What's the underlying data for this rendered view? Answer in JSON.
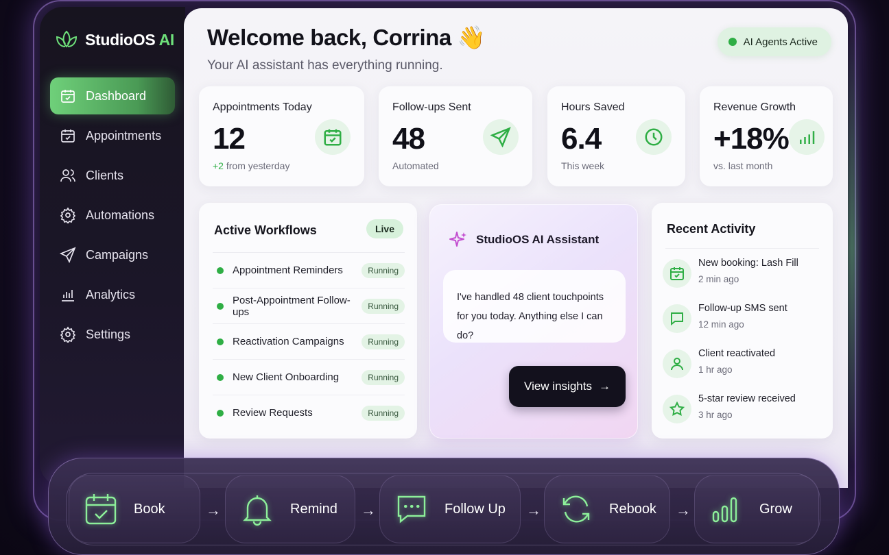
{
  "brand": {
    "name": "StudioOS",
    "suffix": "AI"
  },
  "sidebar": {
    "items": [
      {
        "label": "Dashboard",
        "icon": "calendar-check-icon",
        "active": true
      },
      {
        "label": "Appointments",
        "icon": "calendar-check-icon"
      },
      {
        "label": "Clients",
        "icon": "users-icon"
      },
      {
        "label": "Automations",
        "icon": "gear-icon"
      },
      {
        "label": "Campaigns",
        "icon": "send-icon"
      },
      {
        "label": "Analytics",
        "icon": "bar-chart-icon"
      },
      {
        "label": "Settings",
        "icon": "gear-icon"
      }
    ]
  },
  "header": {
    "title": "Welcome back, Corrina 👋",
    "subtitle": "Your AI assistant has everything running.",
    "status": "AI Agents Active"
  },
  "stats": [
    {
      "label": "Appointments Today",
      "value": "12",
      "sub_highlight": "+2",
      "sub": " from yesterday",
      "icon": "calendar-check-icon"
    },
    {
      "label": "Follow-ups Sent",
      "value": "48",
      "sub_highlight": "",
      "sub": "Automated",
      "icon": "send-icon"
    },
    {
      "label": "Hours Saved",
      "value": "6.4",
      "sub_highlight": "",
      "sub": "This week",
      "icon": "clock-icon"
    },
    {
      "label": "Revenue Growth",
      "value": "+18%",
      "sub_highlight": "",
      "sub": "vs. last month",
      "icon": "bar-chart-icon"
    }
  ],
  "workflows": {
    "title": "Active Workflows",
    "badge": "Live",
    "items": [
      {
        "name": "Appointment Reminders",
        "status": "Running"
      },
      {
        "name": "Post-Appointment Follow-ups",
        "status": "Running"
      },
      {
        "name": "Reactivation Campaigns",
        "status": "Running"
      },
      {
        "name": "New Client Onboarding",
        "status": "Running"
      },
      {
        "name": "Review Requests",
        "status": "Running"
      }
    ]
  },
  "assistant": {
    "title": "StudioOS AI Assistant",
    "message_line1": "I've handled 48 client touchpoints",
    "message_line2": "for you today. Anything else I can do?",
    "button": "View insights",
    "button_arrow": "→"
  },
  "activity": {
    "title": "Recent Activity",
    "items": [
      {
        "text": "New booking: Lash Fill",
        "time": "2 min ago",
        "icon": "calendar-check-icon"
      },
      {
        "text": "Follow-up SMS sent",
        "time": "12 min ago",
        "icon": "chat-icon"
      },
      {
        "text": "Client reactivated",
        "time": "1 hr ago",
        "icon": "user-icon"
      },
      {
        "text": "5-star review received",
        "time": "3 hr ago",
        "icon": "star-icon"
      }
    ]
  },
  "pipeline": {
    "arrow": "→",
    "steps": [
      {
        "label": "Book",
        "icon": "calendar-check-icon"
      },
      {
        "label": "Remind",
        "icon": "bell-icon"
      },
      {
        "label": "Follow Up",
        "icon": "chat-icon"
      },
      {
        "label": "Rebook",
        "icon": "refresh-icon"
      },
      {
        "label": "Grow",
        "icon": "bar-chart-icon"
      }
    ]
  },
  "colors": {
    "accent": "#2fae45",
    "accent_light": "#6ee07a",
    "dark": "#13111d"
  }
}
